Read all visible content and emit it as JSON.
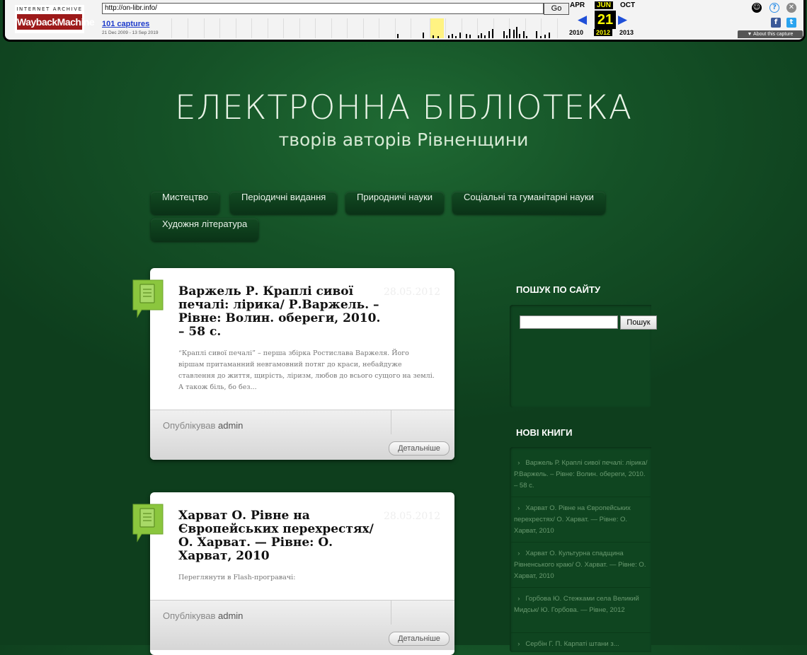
{
  "wayback": {
    "logo_top": "INTERNET ARCHIVE",
    "logo_bottom": "WaybackMachine",
    "url": "http://on-libr.info/",
    "go_label": "Go",
    "captures_link": "101 captures",
    "capture_range": "21 Dec 2009 - 13 Sep 2019",
    "months": {
      "prev": "APR",
      "current": "JUN",
      "next": "OCT"
    },
    "day": "21",
    "years": {
      "prev": "2010",
      "current": "2012",
      "next": "2013"
    },
    "about_label": "About this capture"
  },
  "site": {
    "title": "ЕЛЕКТРОННА БІБЛІОТЕКА",
    "subtitle": "творів авторів Рівненщини"
  },
  "nav": [
    "Мистецтво",
    "Періодичні видання",
    "Природничі науки",
    "Соціальні та гуманітарні науки",
    "Художня література"
  ],
  "posts": [
    {
      "title": "Варжель Р. Краплі сивої печалі: лірика/ Р.Варжель. – Рівне: Волин. обереги, 2010. – 58 с.",
      "date": "28.05.2012",
      "excerpt": "“Краплі сивої печалі” – перша збірка Ростислава Варжеля. Його віршам притаманний невгамовний потяг до краси, небайдуже ставлення до життя, щирість, ліризм, любов до всього сущого на землі. А також біль, бо без...",
      "author_prefix": "Опублікував",
      "author": "admin",
      "more_label": "Детальніше"
    },
    {
      "title": "Харват О. Рівне на Європейських перехрестях/ О. Харват. — Рівне: О. Харват, 2010",
      "date": "28.05.2012",
      "excerpt": "Переглянути в Flash-програвачі:",
      "author_prefix": "Опублікував",
      "author": "admin",
      "more_label": "Детальніше"
    }
  ],
  "sidebar": {
    "search_heading": "ПОШУК ПО САЙТУ",
    "search_button": "Пошук",
    "search_value": "",
    "books_heading": "НОВІ КНИГИ",
    "books": [
      "Варжель Р. Краплі сивої печалі: лірика/ Р.Варжель. – Рівне: Волин. обереги, 2010. – 58 с.",
      "Харват О. Рівне на Європейських перехрестях/ О. Харват. — Рівне: О. Харват, 2010",
      "Харват О. Культурна спадщина Рівненського краю/ О. Харват. — Рівне: О. Харват, 2010",
      "Горбова Ю. Стежками села Великий Мидськ/ Ю. Горбова. — Рівне, 2012",
      "Сербін Г. П. Карпаті штани з..."
    ]
  },
  "colors": {
    "background": "#155227",
    "wayback_highlight": "#fff382",
    "post_icon": "#8bc63e"
  }
}
